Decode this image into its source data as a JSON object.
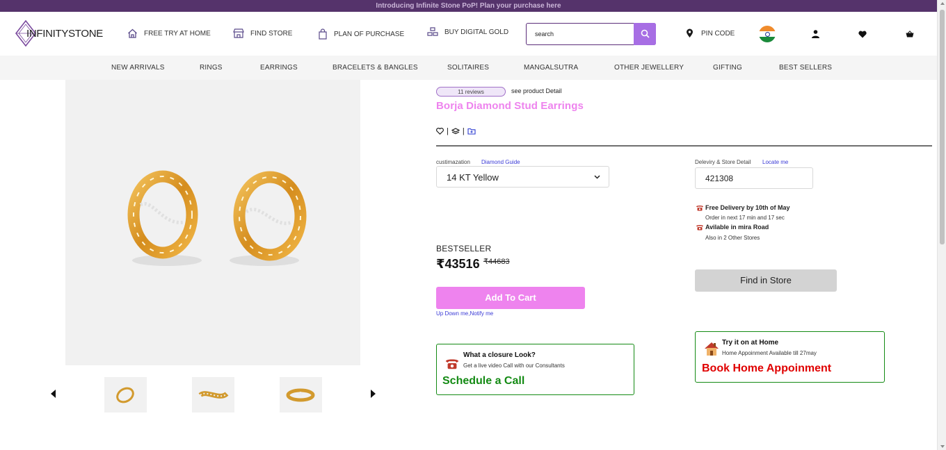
{
  "announcement": "Introducing Infinite Stone PoP! Plan your purchase here",
  "logo": {
    "text": "INFINITYSTONE"
  },
  "header": {
    "nav": [
      {
        "label": "FREE TRY AT HOME",
        "icon": "home-icon"
      },
      {
        "label": "FIND STORE",
        "icon": "store-icon"
      },
      {
        "label": "PLAN OF PURCHASE",
        "icon": "bag-icon"
      },
      {
        "label": "BUY DIGITAL GOLD",
        "icon": "gold-bars-icon"
      }
    ],
    "search": {
      "value": "search",
      "placeholder": "search"
    },
    "pin_code_label": "PIN CODE"
  },
  "categories": [
    "NEW ARRIVALS",
    "RINGS",
    "EARRINGS",
    "BRACELETS & BANGLES",
    "SOLITAIRES",
    "MANGALSUTRA",
    "OTHER JEWELLERY",
    "GIFTING",
    "BEST SELLERS"
  ],
  "product": {
    "reviews": "11 reviews",
    "see_detail": "see product Detail",
    "title": "Borja Diamond Stud Earrings",
    "customization_label": "custimazation",
    "diamond_guide": "Diamond Guide",
    "metal_selected": "14 KT Yellow",
    "delivery_label": "Deleviry & Store Detail",
    "locate_me": "Locate me",
    "pincode": "421308",
    "delivery_title": "Free Delivery by 10th of May",
    "delivery_sub": "Order in next 17 min and 17 sec",
    "available_title": "Avilable in mira Road",
    "available_sub": "Also in 2 Other Stores",
    "badge": "BESTSELLER",
    "price": "₹43516",
    "old_price": "₹44683",
    "add_to_cart": "Add To Cart",
    "notify": "Up Down me,Notify me",
    "find_in_store": "Find in Store"
  },
  "cards": {
    "video": {
      "title": "What a closure Look?",
      "sub": "Get a live video Call with our Consultants",
      "cta": "Schedule a Call",
      "cta_color": "#138a13"
    },
    "home": {
      "title": "Try it on at Home",
      "sub": "Home Appoinment Available till 27may",
      "cta": "Book Home Appoinment",
      "cta_color": "#e00000"
    }
  },
  "colors": {
    "brand_purple": "#55336b",
    "accent_pink": "#ee83ee",
    "search_purple": "#a76ee4",
    "card_border": "#138a13"
  }
}
